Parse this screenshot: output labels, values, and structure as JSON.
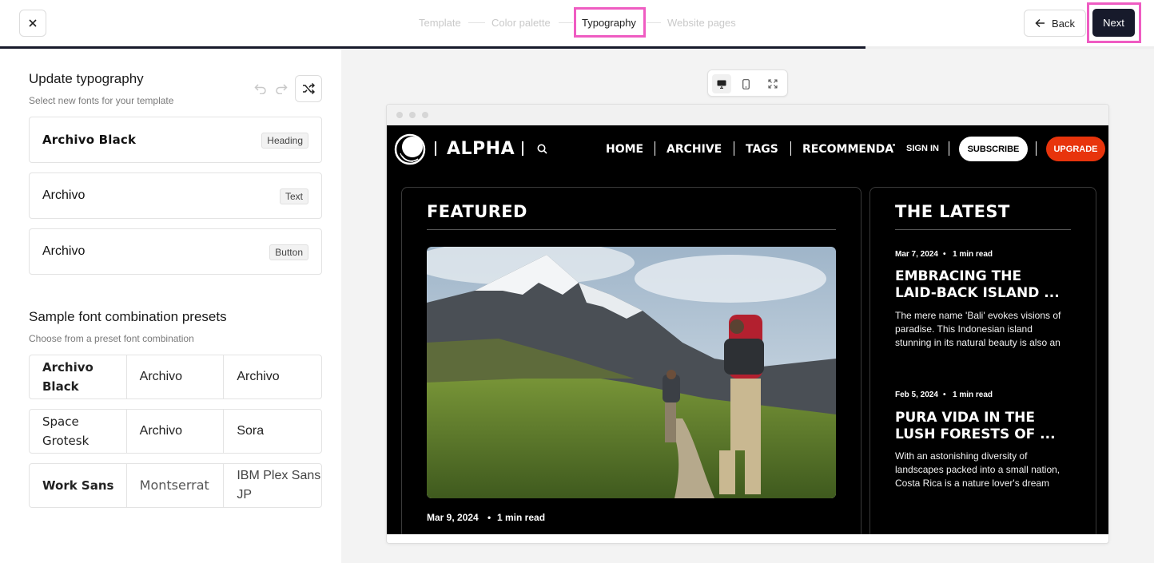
{
  "stepper": {
    "steps": [
      {
        "label": "Template",
        "state": "done"
      },
      {
        "label": "Color palette",
        "state": "done"
      },
      {
        "label": "Typography",
        "state": "active"
      },
      {
        "label": "Website pages",
        "state": "upcoming"
      }
    ],
    "progress_percent": 75
  },
  "header": {
    "back_label": "Back",
    "next_label": "Next"
  },
  "typography": {
    "title": "Update typography",
    "subtitle": "Select new fonts for your template",
    "fonts": [
      {
        "name": "Archivo Black",
        "role": "Heading"
      },
      {
        "name": "Archivo",
        "role": "Text"
      },
      {
        "name": "Archivo",
        "role": "Button"
      }
    ]
  },
  "presets": {
    "title": "Sample font combination presets",
    "subtitle": "Choose from a preset font combination",
    "rows": [
      [
        "Archivo Black",
        "Archivo",
        "Archivo"
      ],
      [
        "Space Grotesk",
        "Archivo",
        "Sora"
      ],
      [
        "Work Sans",
        "Montserrat",
        "IBM Plex Sans JP"
      ]
    ]
  },
  "preview": {
    "device": "desktop",
    "site": {
      "title": "ALPHA",
      "nav": [
        "HOME",
        "ARCHIVE",
        "TAGS",
        "RECOMMENDATIONS"
      ],
      "signin": "SIGN IN",
      "subscribe": "SUBSCRIBE",
      "upgrade": "UPGRADE",
      "featured": {
        "heading": "FEATURED",
        "date": "Mar 9, 2024",
        "read": "1 min read"
      },
      "latest": {
        "heading": "THE LATEST",
        "posts": [
          {
            "date": "Mar 7, 2024",
            "read": "1 min read",
            "title": "EMBRACING THE LAID-BACK ISLAND ...",
            "body": "The mere name 'Bali' evokes visions of paradise. This Indonesian island stunning in its natural beauty is also an"
          },
          {
            "date": "Feb 5, 2024",
            "read": "1 min read",
            "title": "PURA VIDA IN THE LUSH FORESTS OF ...",
            "body": "With an astonishing diversity of landscapes packed into a small nation, Costa Rica is a nature lover's dream"
          }
        ]
      }
    }
  },
  "colors": {
    "accent_dark": "#171a2b",
    "highlight": "#ef5cc2",
    "upgrade": "#e8340c"
  }
}
